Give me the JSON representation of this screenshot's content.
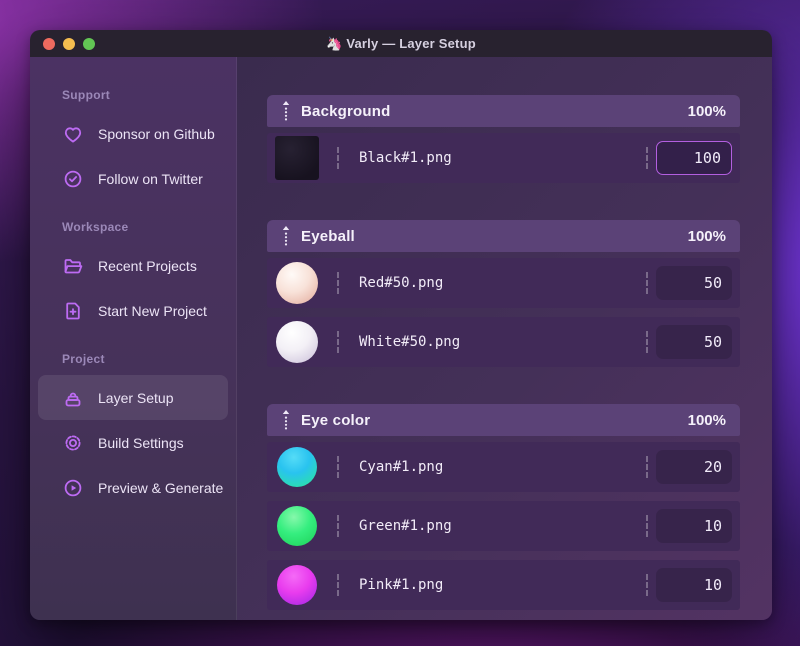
{
  "window": {
    "title": "🦄 Varly — Layer Setup",
    "traffic_lights": {
      "close": "#ee6a5f",
      "minimize": "#f5bd4f",
      "zoom": "#62c554"
    }
  },
  "sidebar": {
    "sections": [
      {
        "label": "Support",
        "items": [
          {
            "label": "Sponsor on Github",
            "icon": "heart-icon"
          },
          {
            "label": "Follow on Twitter",
            "icon": "badge-check-icon"
          }
        ]
      },
      {
        "label": "Workspace",
        "items": [
          {
            "label": "Recent Projects",
            "icon": "folder-open-icon"
          },
          {
            "label": "Start New Project",
            "icon": "file-plus-icon"
          }
        ]
      },
      {
        "label": "Project",
        "items": [
          {
            "label": "Layer Setup",
            "icon": "layers-icon",
            "active": true
          },
          {
            "label": "Build Settings",
            "icon": "gear-icon"
          },
          {
            "label": "Preview & Generate",
            "icon": "play-circle-icon"
          }
        ]
      }
    ]
  },
  "layers": {
    "groups": [
      {
        "name": "Background",
        "opacity": "100%",
        "items": [
          {
            "file": "Black#1.png",
            "weight": "100",
            "thumb": "black",
            "focused": true
          }
        ]
      },
      {
        "name": "Eyeball",
        "opacity": "100%",
        "items": [
          {
            "file": "Red#50.png",
            "weight": "50",
            "thumb": "red-sphere"
          },
          {
            "file": "White#50.png",
            "weight": "50",
            "thumb": "white-sphere"
          }
        ]
      },
      {
        "name": "Eye color",
        "opacity": "100%",
        "items": [
          {
            "file": "Cyan#1.png",
            "weight": "20",
            "thumb": "cyan-sphere"
          },
          {
            "file": "Green#1.png",
            "weight": "10",
            "thumb": "green-sphere"
          },
          {
            "file": "Pink#1.png",
            "weight": "10",
            "thumb": "pink-sphere"
          }
        ]
      }
    ]
  },
  "colors": {
    "accent": "#b35fe0",
    "icon": "#bd6bf3",
    "group_header_bg": "#5b4277",
    "row_bg": "#412a58"
  }
}
